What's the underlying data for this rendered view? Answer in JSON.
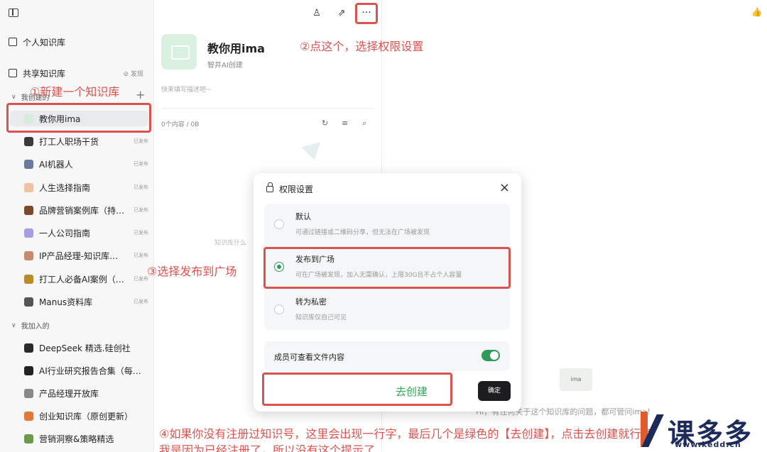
{
  "sidebar": {
    "personal_kb": "个人知识库",
    "shared_kb": "共享知识库",
    "discover": "⊘ 发现",
    "created_group": "我创建的",
    "joined_group": "我加入的",
    "created_items": [
      {
        "name": "教你用ima",
        "badge": "",
        "color": "#d6ecdc"
      },
      {
        "name": "打工人职场干货",
        "badge": "已发布",
        "color": "#3a3a3a"
      },
      {
        "name": "AI机器人",
        "badge": "已发布",
        "color": "#6b7a9a"
      },
      {
        "name": "人生选择指南",
        "badge": "已发布",
        "color": "#f0c2a4"
      },
      {
        "name": "品牌营销案例库（持…",
        "badge": "已发布",
        "color": "#7a4a2a"
      },
      {
        "name": "一人公司指南",
        "badge": "已发布",
        "color": "#a99ce0"
      },
      {
        "name": "IP产品经理-知识库…",
        "badge": "已发布",
        "color": "#c78a6a"
      },
      {
        "name": "打工人必备AI案例（…",
        "badge": "已发布",
        "color": "#b88a2a"
      },
      {
        "name": "Manus资料库",
        "badge": "已发布",
        "color": "#555555"
      }
    ],
    "joined_items": [
      {
        "name": "DeepSeek 精选.硅创社",
        "color": "#2a2a2a"
      },
      {
        "name": "AI行业研究报告合集（每…",
        "color": "#222222"
      },
      {
        "name": "产品经理开放库",
        "color": "#888888"
      },
      {
        "name": "创业知识库（原创更新）",
        "color": "#e07a3a"
      },
      {
        "name": "营销洞察&策略精选",
        "color": "#6a9a4a"
      }
    ]
  },
  "kb": {
    "title": "教你用ima",
    "subtitle": "智井AI创建",
    "desc_placeholder": "快来填写描述吧~",
    "count": "0个内容 / 0B",
    "empty_hint": "知识库什么"
  },
  "topbar": {
    "more_label": "···"
  },
  "right": {
    "hi_text": "Hi，有任何关于这个知识库的问题，都可管问ima！",
    "logo_text": "ima"
  },
  "dialog": {
    "title": "权限设置",
    "close": "×",
    "options": [
      {
        "title": "默认",
        "desc": "可通过链接或二维码分享，但无法在广场被发现",
        "selected": false
      },
      {
        "title": "发布到广场",
        "desc": "可在广场被发现，加入无需确认，上限30G且不占个人容量",
        "selected": true
      },
      {
        "title": "转为私密",
        "desc": "知识库仅自己可见",
        "selected": false
      }
    ],
    "member_view": "成员可查看文件内容",
    "member_view_on": true,
    "go_create": "去创建",
    "confirm": "确定"
  },
  "annotations": {
    "step1": "①新建一个知识库",
    "step2": "②点这个，选择权限设置",
    "step3": "③选择发布到广场",
    "step4_line1": "④如果你没有注册过知识号，这里会出现一行字，最后几个是绿色的【去创建】，点击去创建就行了",
    "step4_line2": "我是因为已经注册了，所以没有这个提示了"
  },
  "watermark": {
    "name": "课多多",
    "url": "www.kedd.cn"
  },
  "colors": {
    "annotation": "#d9534f",
    "accent_green": "#2e9a57",
    "brand_navy": "#1d2b5a",
    "brand_orange": "#e2592c"
  }
}
